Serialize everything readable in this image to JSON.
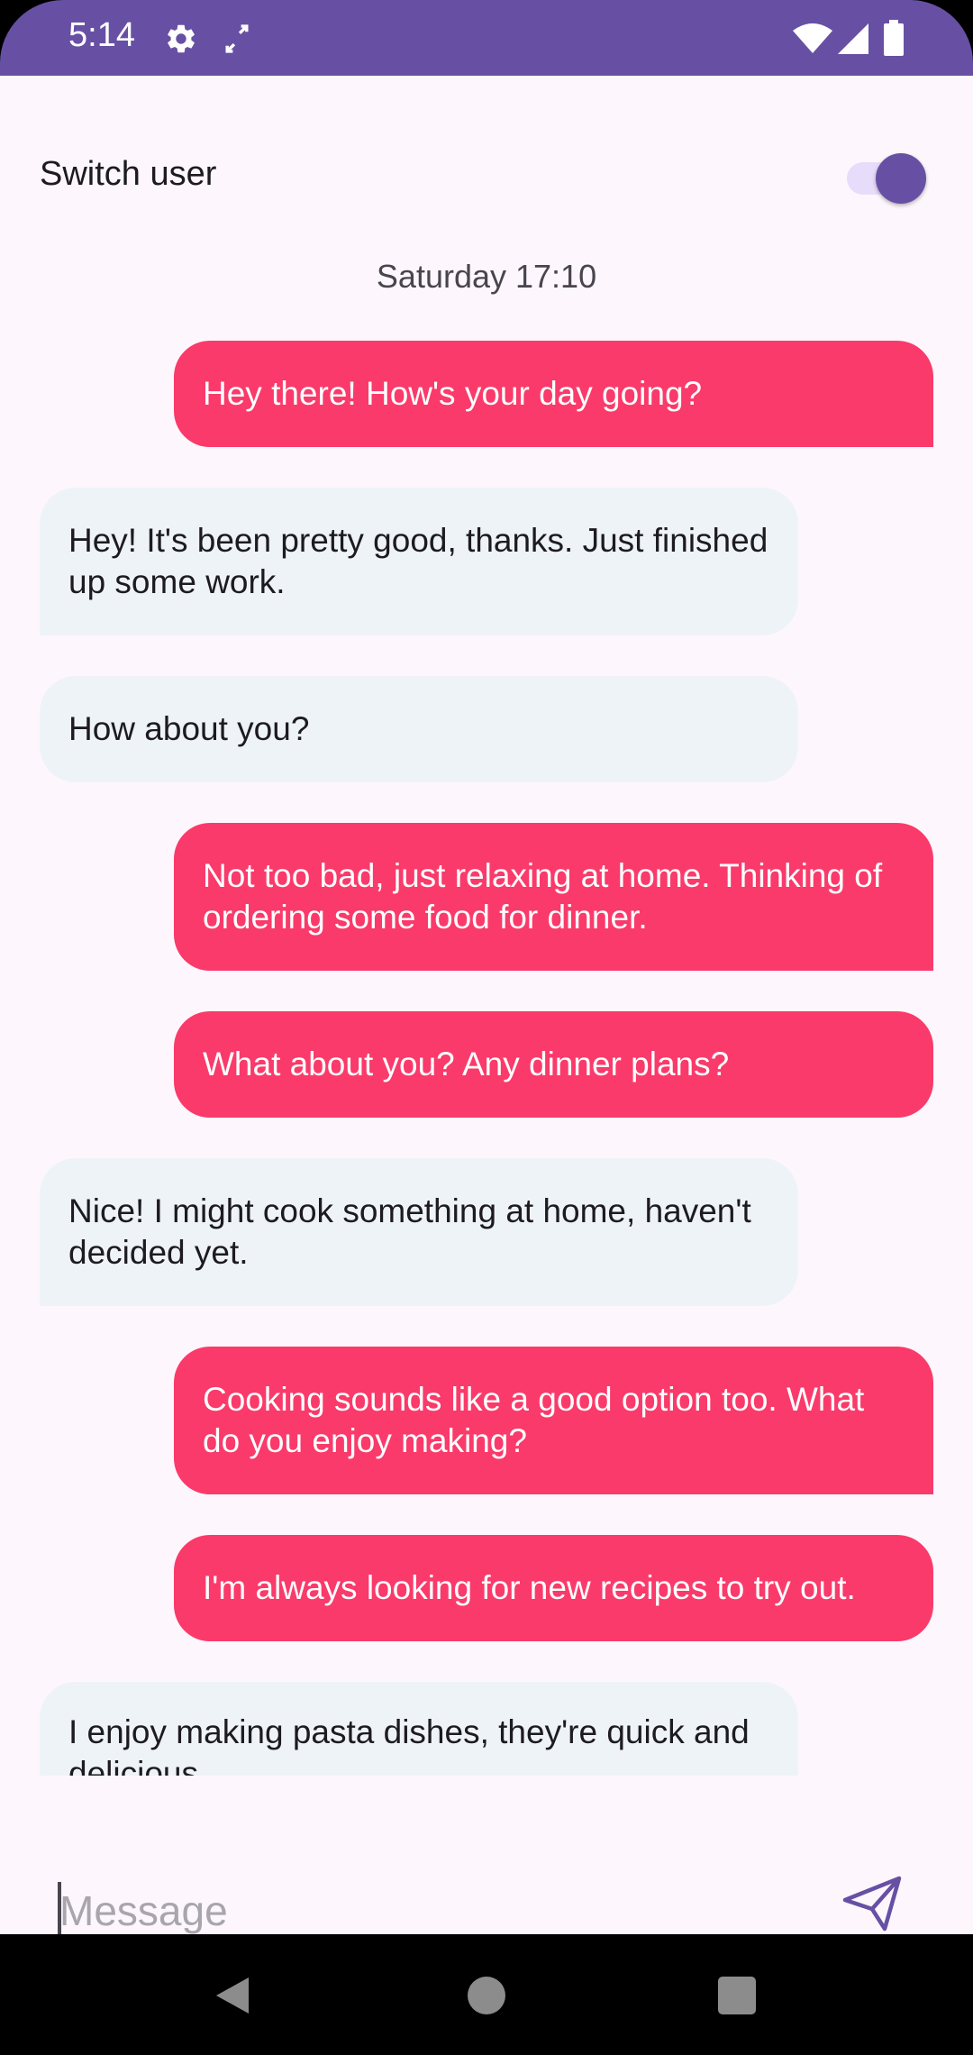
{
  "status_bar": {
    "time": "5:14",
    "icons": [
      "gear-icon",
      "expand-icon",
      "wifi-icon",
      "signal-icon",
      "battery-icon"
    ],
    "color": "#6750a4"
  },
  "header": {
    "switch_label": "Switch user",
    "switch_on": true
  },
  "chat": {
    "date_label": "Saturday 17:10",
    "messages": [
      {
        "from": "sent",
        "text": "Hey there! How's your day going?"
      },
      {
        "from": "received",
        "text": "Hey! It's been pretty good, thanks. Just finished up some work."
      },
      {
        "from": "received",
        "text": "How about you?"
      },
      {
        "from": "sent",
        "text": "Not too bad, just relaxing at home. Thinking of ordering some food for dinner."
      },
      {
        "from": "sent",
        "text": "What about you? Any dinner plans?"
      },
      {
        "from": "received",
        "text": "Nice! I might cook something at home, haven't decided yet."
      },
      {
        "from": "sent",
        "text": "Cooking sounds like a good option too. What do you enjoy making?"
      },
      {
        "from": "sent",
        "text": "I'm always looking for new recipes to try out."
      },
      {
        "from": "received",
        "text": "I enjoy making pasta dishes, they're quick and delicious."
      }
    ]
  },
  "input": {
    "placeholder": "Message",
    "value": ""
  },
  "colors": {
    "sent_bubble": "#fa3a6a",
    "received_bubble": "#eef3f8",
    "accent": "#6750a4",
    "background": "#fdf7fd"
  },
  "nav": {
    "icons": [
      "back-icon",
      "home-icon",
      "recents-icon"
    ]
  }
}
